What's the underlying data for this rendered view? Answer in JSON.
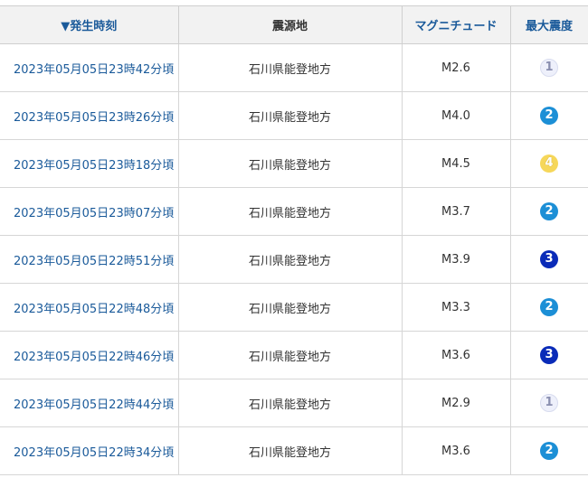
{
  "header": {
    "time": "▼発生時刻",
    "epicenter": "震源地",
    "magnitude": "マグニチュード",
    "intensity": "最大震度"
  },
  "rows": [
    {
      "time": "2023年05月05日23時42分頃",
      "place": "石川県能登地方",
      "mag": "M2.6",
      "int": "1",
      "int_color": "#eef0fb"
    },
    {
      "time": "2023年05月05日23時26分頃",
      "place": "石川県能登地方",
      "mag": "M4.0",
      "int": "2",
      "int_color": "#1c8fd6"
    },
    {
      "time": "2023年05月05日23時18分頃",
      "place": "石川県能登地方",
      "mag": "M4.5",
      "int": "4",
      "int_color": "#f6d75a"
    },
    {
      "time": "2023年05月05日23時07分頃",
      "place": "石川県能登地方",
      "mag": "M3.7",
      "int": "2",
      "int_color": "#1c8fd6"
    },
    {
      "time": "2023年05月05日22時51分頃",
      "place": "石川県能登地方",
      "mag": "M3.9",
      "int": "3",
      "int_color": "#0a2bb8"
    },
    {
      "time": "2023年05月05日22時48分頃",
      "place": "石川県能登地方",
      "mag": "M3.3",
      "int": "2",
      "int_color": "#1c8fd6"
    },
    {
      "time": "2023年05月05日22時46分頃",
      "place": "石川県能登地方",
      "mag": "M3.6",
      "int": "3",
      "int_color": "#0a2bb8"
    },
    {
      "time": "2023年05月05日22時44分頃",
      "place": "石川県能登地方",
      "mag": "M2.9",
      "int": "1",
      "int_color": "#eef0fb"
    },
    {
      "time": "2023年05月05日22時34分頃",
      "place": "石川県能登地方",
      "mag": "M3.6",
      "int": "2",
      "int_color": "#1c8fd6"
    }
  ],
  "colors": {
    "link": "#1a5a9a",
    "header_bg": "#f2f2f2",
    "border": "#d6d6d6"
  }
}
